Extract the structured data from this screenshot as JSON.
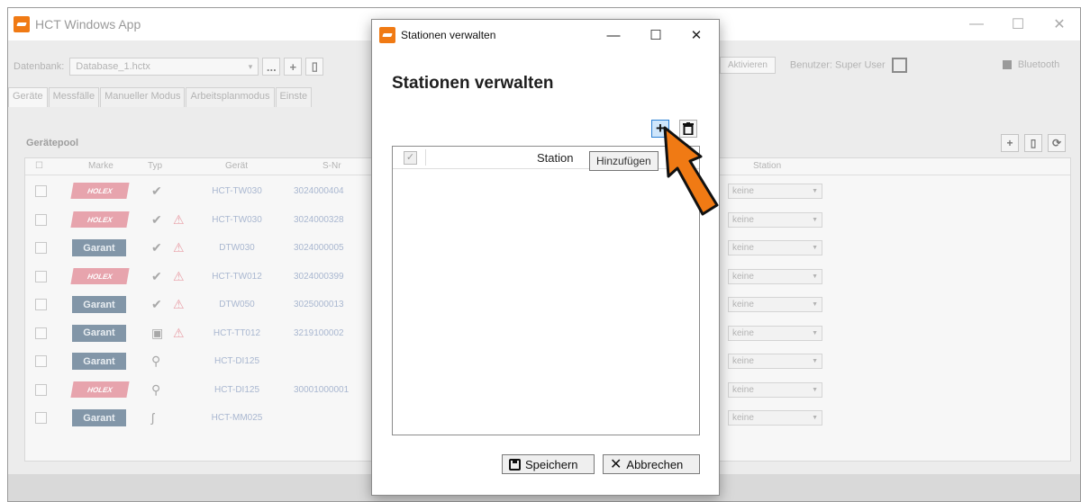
{
  "main_window": {
    "title": "HCT Windows App",
    "controls": {
      "minimize": "—",
      "maximize": "☐",
      "close": "✕"
    }
  },
  "toolbar": {
    "db_label": "Datenbank:",
    "db_value": "Database_1.hctx",
    "browse_label": "...",
    "activate_label": "Aktivieren",
    "user_label": "Benutzer: Super User",
    "bluetooth_label": "Bluetooth"
  },
  "tabs": [
    "Geräte",
    "Messfälle",
    "Manueller Modus",
    "Arbeitsplanmodus",
    "Einste"
  ],
  "pool": {
    "title": "Gerätepool",
    "columns": {
      "brand": "Marke",
      "type": "Typ",
      "device": "Gerät",
      "snr": "S-Nr",
      "station": "Station"
    },
    "rows": [
      {
        "brand": "HOLEX",
        "type_icon": "✔",
        "warning": false,
        "device": "HCT-TW030",
        "snr": "3024000404",
        "station": "keine"
      },
      {
        "brand": "HOLEX",
        "type_icon": "✔",
        "warning": true,
        "device": "HCT-TW030",
        "snr": "3024000328",
        "station": "keine"
      },
      {
        "brand": "Garant",
        "type_icon": "✔",
        "warning": true,
        "device": "DTW030",
        "snr": "3024000005",
        "station": "keine"
      },
      {
        "brand": "HOLEX",
        "type_icon": "✔",
        "warning": true,
        "device": "HCT-TW012",
        "snr": "3024000399",
        "station": "keine"
      },
      {
        "brand": "Garant",
        "type_icon": "✔",
        "warning": true,
        "device": "DTW050",
        "snr": "3025000013",
        "station": "keine"
      },
      {
        "brand": "Garant",
        "type_icon": "▣",
        "warning": true,
        "device": "HCT-TT012",
        "snr": "3219100002",
        "station": "keine"
      },
      {
        "brand": "Garant",
        "type_icon": "⚲",
        "warning": false,
        "device": "HCT-DI125",
        "snr": "",
        "station": "keine"
      },
      {
        "brand": "HOLEX",
        "type_icon": "⚲",
        "warning": false,
        "device": "HCT-DI125",
        "snr": "30001000001",
        "station": "keine"
      },
      {
        "brand": "Garant",
        "type_icon": "ʃ",
        "warning": false,
        "device": "HCT-MM025",
        "snr": "",
        "station": "keine"
      }
    ]
  },
  "dialog": {
    "window_title": "Stationen verwalten",
    "heading": "Stationen verwalten",
    "add_glyph": "+",
    "delete_glyph": "🗑",
    "tooltip": "Hinzufügen",
    "list_header_station": "Station",
    "header_check": "✓",
    "save_label": "Speichern",
    "cancel_label": "Abbrechen",
    "cancel_glyph": "✕"
  },
  "colors": {
    "accent_orange": "#f07a14",
    "selected_blue": "#2a7fd4",
    "holex_red": "#d81e3c",
    "garant_blue": "#1f3e5e"
  }
}
